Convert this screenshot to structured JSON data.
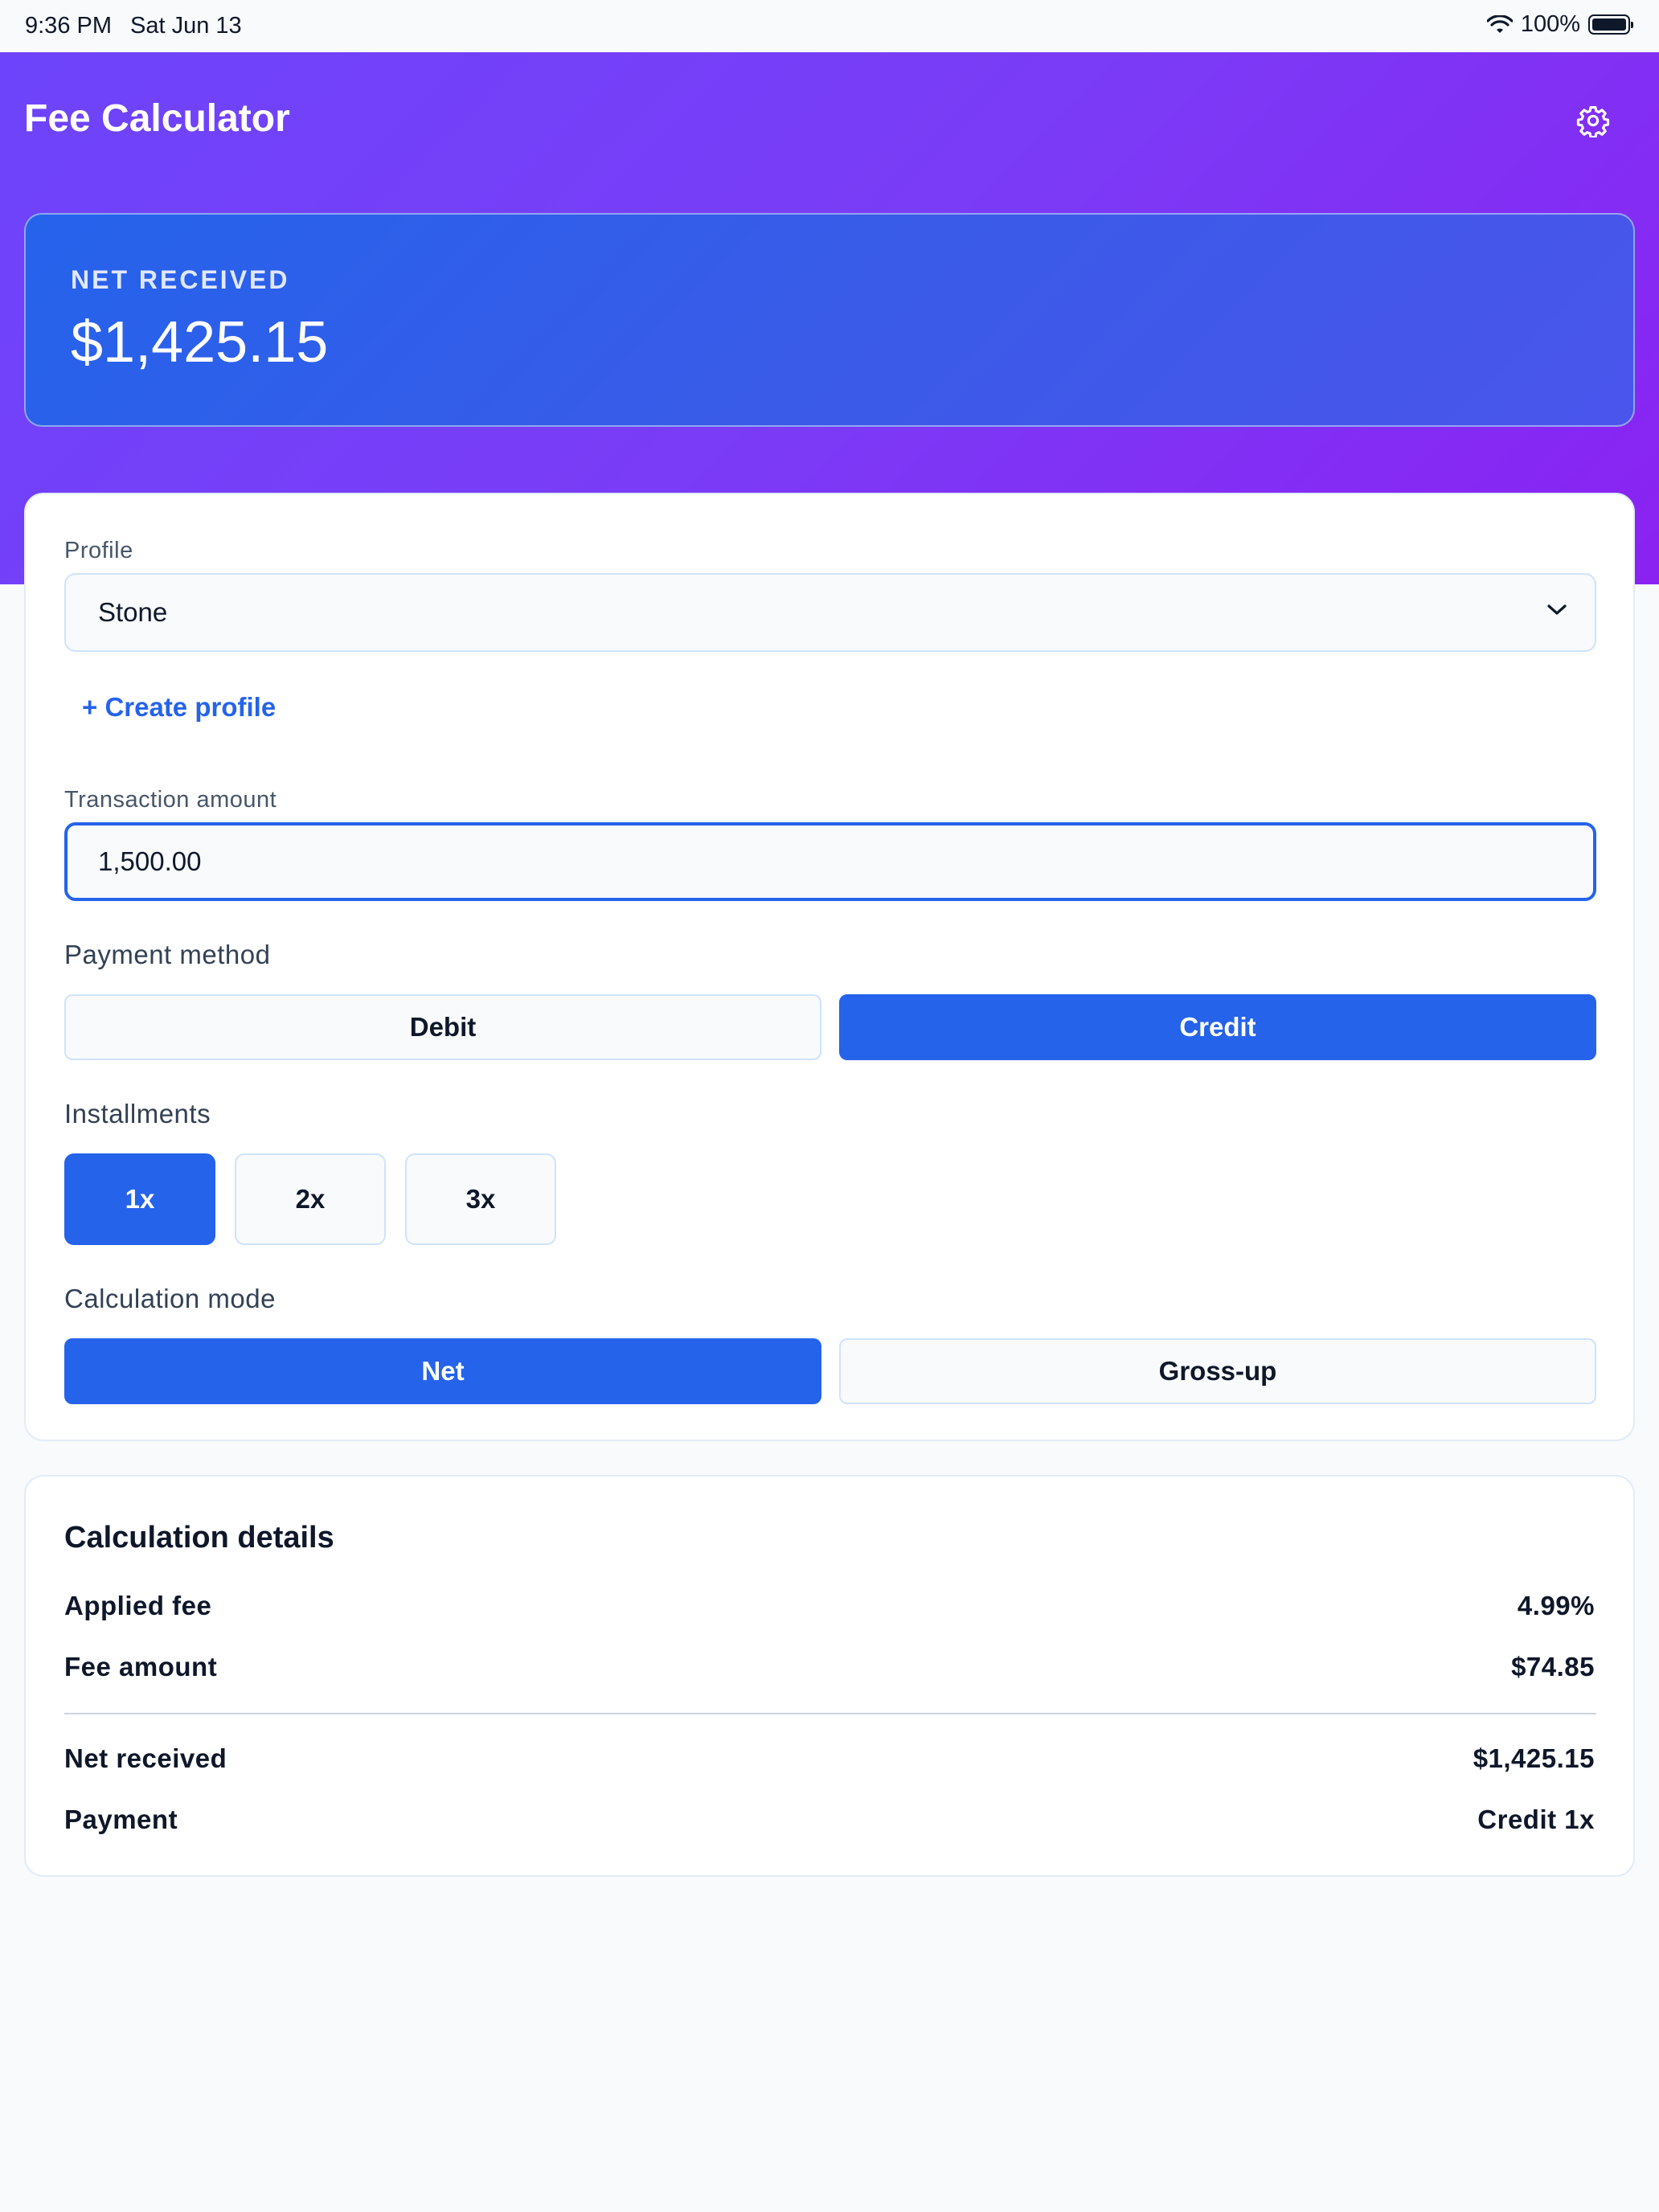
{
  "status_bar": {
    "time": "9:36 PM",
    "date": "Sat Jun 13",
    "battery": "100%"
  },
  "header": {
    "title": "Fee Calculator",
    "settings_icon": "gear-icon"
  },
  "hero": {
    "label": "NET RECEIVED",
    "value": "$1,425.15"
  },
  "form": {
    "profile_label": "Profile",
    "profile_value": "Stone",
    "create_profile": "+ Create profile",
    "amount_label": "Transaction amount",
    "amount_value": "1,500.00",
    "payment_method_label": "Payment method",
    "payment_methods": [
      {
        "label": "Debit",
        "selected": false
      },
      {
        "label": "Credit",
        "selected": true
      }
    ],
    "installments_label": "Installments",
    "installments": [
      {
        "label": "1x",
        "selected": true
      },
      {
        "label": "2x",
        "selected": false
      },
      {
        "label": "3x",
        "selected": false
      }
    ],
    "mode_label": "Calculation mode",
    "modes": [
      {
        "label": "Net",
        "selected": true
      },
      {
        "label": "Gross-up",
        "selected": false
      }
    ]
  },
  "details": {
    "title": "Calculation details",
    "rows": [
      {
        "label": "Applied fee",
        "value": "4.99%"
      },
      {
        "label": "Fee amount",
        "value": "$74.85"
      },
      {
        "label": "Net received",
        "value": "$1,425.15"
      },
      {
        "label": "Payment",
        "value": "Credit 1x"
      }
    ]
  },
  "colors": {
    "accent": "#2563eb",
    "header_gradient_start": "#6d44fb",
    "header_gradient_end": "#8a22f2"
  }
}
